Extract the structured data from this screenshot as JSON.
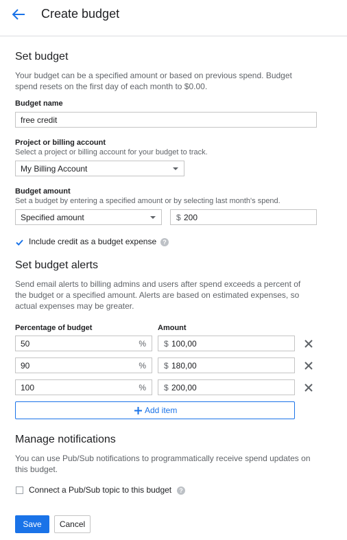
{
  "header": {
    "title": "Create budget"
  },
  "set_budget": {
    "heading": "Set budget",
    "description": "Your budget can be a specified amount or based on previous spend. Budget spend resets on the first day of each month to $0.00.",
    "name_label": "Budget name",
    "name_value": "free credit",
    "project_label": "Project or billing account",
    "project_help": "Select a project or billing account for your budget to track.",
    "project_value": "My Billing Account",
    "amount_label": "Budget amount",
    "amount_help": "Set a budget by entering a specified amount or by selecting last month's spend.",
    "amount_type": "Specified amount",
    "currency": "$",
    "amount_value": "200",
    "include_credit_label": "Include credit as a budget expense",
    "include_credit_checked": true
  },
  "alerts": {
    "heading": "Set budget alerts",
    "description": "Send email alerts to billing admins and users after spend exceeds a percent of the budget or a specified amount. Alerts are based on estimated expenses, so actual expenses may be greater.",
    "col_percent": "Percentage of budget",
    "col_amount": "Amount",
    "pct_symbol": "%",
    "currency": "$",
    "rows": [
      {
        "percent": "50",
        "amount": "100,00"
      },
      {
        "percent": "90",
        "amount": "180,00"
      },
      {
        "percent": "100",
        "amount": "200,00"
      }
    ],
    "add_item_label": "Add item"
  },
  "notifications": {
    "heading": "Manage notifications",
    "description": "You can use Pub/Sub notifications to programmatically receive spend updates on this budget.",
    "pubsub_label": "Connect a Pub/Sub topic to this budget",
    "pubsub_checked": false
  },
  "actions": {
    "save_label": "Save",
    "cancel_label": "Cancel"
  },
  "colors": {
    "accent": "#1a73e8",
    "text": "#202124",
    "muted": "#5f6368",
    "border": "#c4c4c4"
  }
}
